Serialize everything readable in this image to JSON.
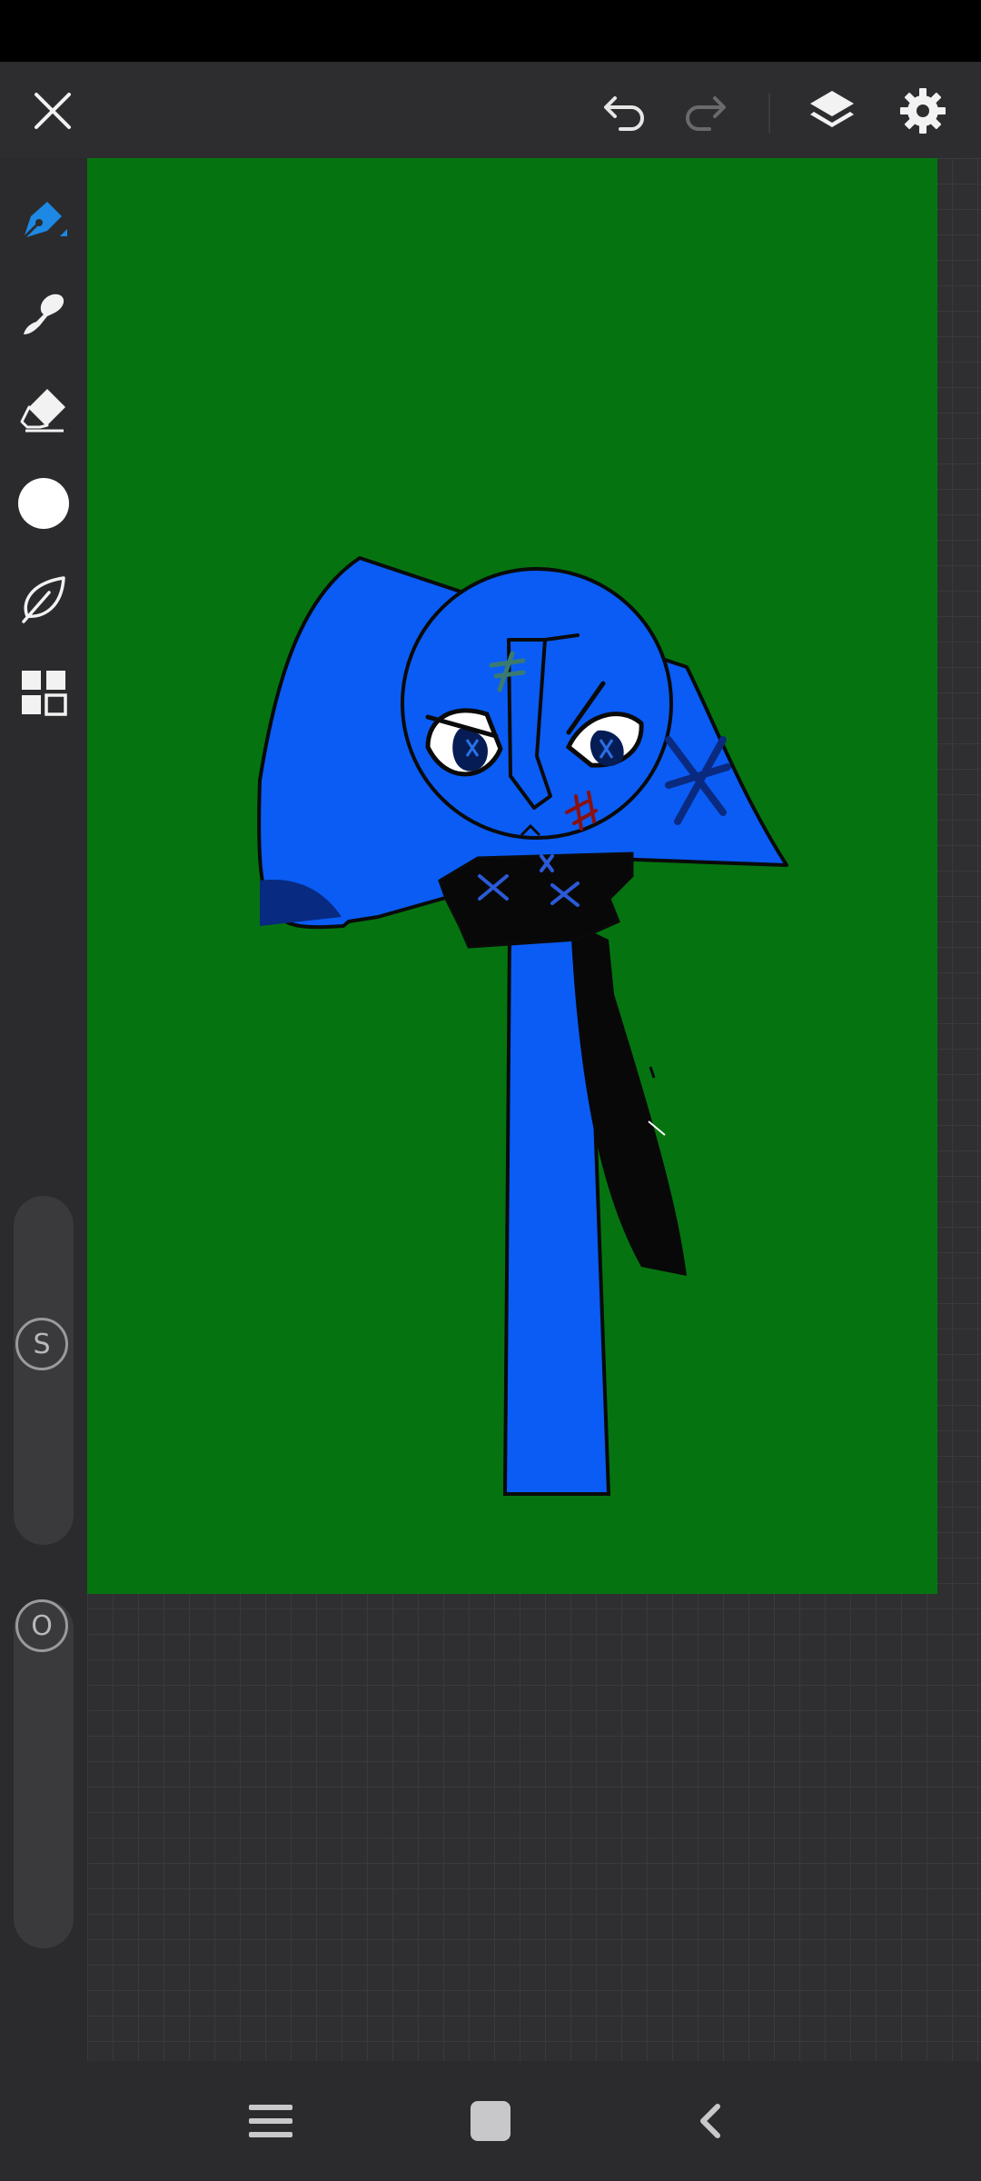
{
  "app": {
    "accent_color": "#1e88e5",
    "canvas_color": "#057410",
    "character_blue": "#0a5cf5"
  },
  "top_toolbar": {
    "close": {
      "icon": "close-icon"
    },
    "undo": {
      "icon": "undo-icon",
      "enabled": true
    },
    "redo": {
      "icon": "redo-icon",
      "enabled": false
    },
    "layers": {
      "icon": "layers-icon"
    },
    "settings": {
      "icon": "gear-icon"
    }
  },
  "tools": [
    {
      "name": "pen",
      "icon": "pen-icon",
      "selected": true
    },
    {
      "name": "smudge",
      "icon": "smudge-brush-icon",
      "selected": false
    },
    {
      "name": "eraser",
      "icon": "eraser-icon",
      "selected": false
    },
    {
      "name": "color",
      "icon": "color-swatch-icon",
      "value": "#ffffff",
      "selected": false
    },
    {
      "name": "brush-library",
      "icon": "leaf-brush-icon",
      "selected": false
    },
    {
      "name": "more-tools",
      "icon": "grid-menu-icon",
      "selected": false
    }
  ],
  "sliders": {
    "size": {
      "label": "S",
      "value_fraction": 0.42
    },
    "opacity": {
      "label": "O",
      "value_fraction": 0.0
    }
  },
  "nav_bar": {
    "menu": {
      "icon": "menu-icon"
    },
    "home": {
      "icon": "home-icon"
    },
    "back": {
      "icon": "back-icon"
    }
  }
}
